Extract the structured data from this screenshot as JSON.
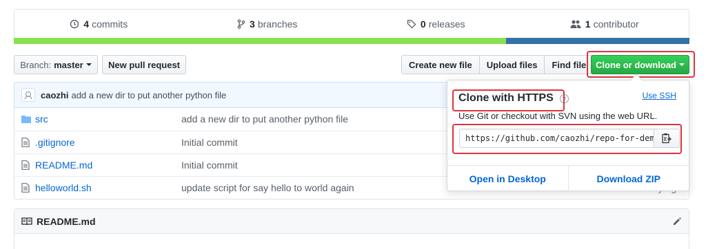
{
  "summary": {
    "commits_count": "4",
    "commits_label": "commits",
    "branches_count": "3",
    "branches_label": "branches",
    "releases_count": "0",
    "releases_label": "releases",
    "contributors_count": "1",
    "contributors_label": "contributor"
  },
  "language_bar": {
    "colors": [
      "#89e051",
      "#3572a5"
    ]
  },
  "toolbar": {
    "branch_prefix": "Branch:",
    "branch_name": "master",
    "new_pr": "New pull request",
    "create_file": "Create new file",
    "upload_files": "Upload files",
    "find_file": "Find file",
    "clone_download": "Clone or download"
  },
  "commit": {
    "author": "caozhi",
    "message": "add a new dir to put another python file"
  },
  "files": [
    {
      "name": "src",
      "type": "folder-icon",
      "message": "add a new dir to put another python file",
      "age": ""
    },
    {
      "name": ".gitignore",
      "type": "file-icon",
      "message": "Initial commit",
      "age": ""
    },
    {
      "name": "README.md",
      "type": "file-icon",
      "message": "Initial commit",
      "age": ""
    },
    {
      "name": "helloworld.sh",
      "type": "file-icon",
      "message": "update script for say hello to world again",
      "age": "a day ago"
    }
  ],
  "readme": {
    "title": "README.md"
  },
  "clone_dropdown": {
    "title": "Clone with HTTPS",
    "help": "?",
    "use_ssh": "Use SSH",
    "subtitle": "Use Git or checkout with SVN using the web URL.",
    "url": "https://github.com/caozhi/repo-for-demo.git",
    "open_desktop": "Open in Desktop",
    "download_zip": "Download ZIP"
  },
  "colors": {
    "accent_green": "#28a745",
    "link": "#0366d6",
    "highlight": "#e0323e"
  }
}
